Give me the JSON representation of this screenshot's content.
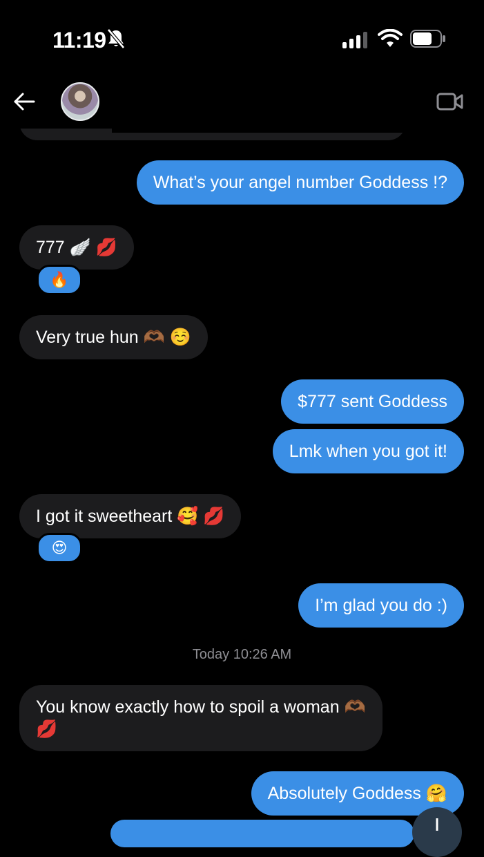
{
  "status_bar": {
    "time": "11:19",
    "icons": [
      "bell-slash-icon",
      "signal-icon",
      "wifi-icon",
      "battery-icon"
    ]
  },
  "header": {
    "back_icon": "arrow-left-icon",
    "avatar": "contact-avatar",
    "video_icon": "video-camera-icon"
  },
  "messages": [
    {
      "side": "sent",
      "text": "What’s your angel number Goddess !?"
    },
    {
      "side": "received",
      "text": "777 🪽 💋",
      "reaction": "🔥"
    },
    {
      "side": "received",
      "text": "Very true hun 🫶🏾 ☺️"
    },
    {
      "side": "sent",
      "text": "$777 sent Goddess"
    },
    {
      "side": "sent",
      "text": "Lmk when you got it!"
    },
    {
      "side": "received",
      "text": "I got it sweetheart 🥰 💋",
      "reaction": "😍"
    },
    {
      "side": "sent",
      "text": "I’m glad you do :)"
    },
    {
      "side": "received",
      "text_line1": "You know exactly how to spoil a woman 🫶🏾",
      "text_line2": "💋"
    },
    {
      "side": "sent",
      "text": "Absolutely Goddess 🤗"
    }
  ],
  "timestamp": "Today 10:26 AM",
  "colors": {
    "sent_bubble": "#3b8fe6",
    "received_bubble": "#1c1c1e",
    "background": "#000000",
    "timestamp": "#8e8e93"
  }
}
